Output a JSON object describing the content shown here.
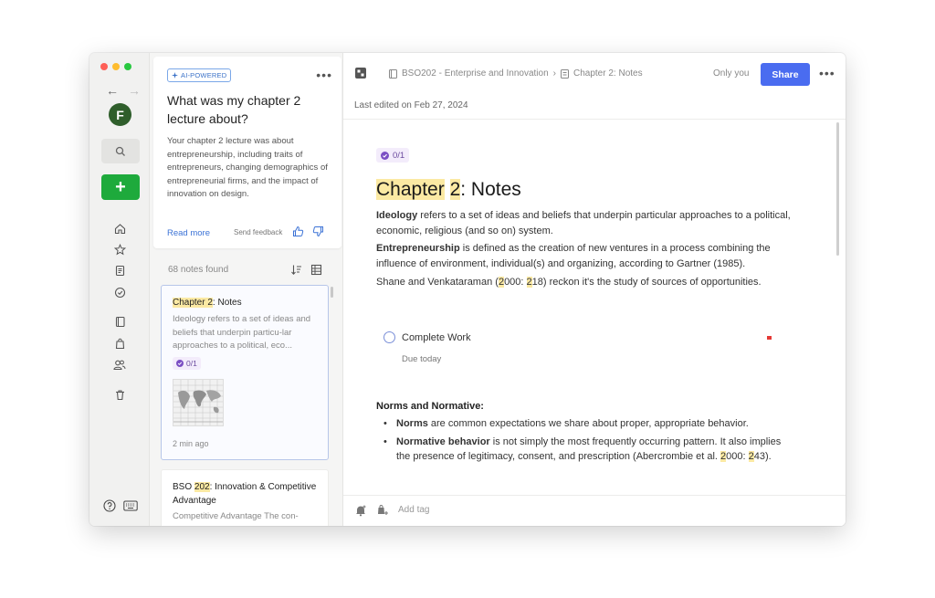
{
  "rail": {
    "avatar_letter": "F"
  },
  "ai_card": {
    "badge": "AI-POWERED",
    "question": "What was my chapter 2 lecture about?",
    "answer": "Your chapter 2 lecture was about entrepreneurship, including traits of entrepreneurs, changing demographics of entrepreneurial firms, and the impact of innovation on design.",
    "read_more": "Read more",
    "send_feedback": "Send feedback"
  },
  "notes_list": {
    "count_label": "68 notes found",
    "items": [
      {
        "title_hl": "Chapter 2",
        "title_rest": ": Notes",
        "preview": "Ideology refers to a set of ideas and beliefs that underpin particu-lar approaches to a political, eco...",
        "badge": "0/1",
        "time": "2 min ago"
      },
      {
        "title_pre": "BSO ",
        "title_hl": "202",
        "title_rest": ": Innovation & Competitive Advantage",
        "preview": "Competitive Advantage The con-"
      }
    ]
  },
  "editor": {
    "breadcrumb": [
      "BSO202 - Enterprise and Innovation",
      "Chapter 2: Notes"
    ],
    "visibility": "Only you",
    "share_label": "Share",
    "last_edited": "Last edited on Feb 27, 2024",
    "task_badge": "0/1",
    "title_hl1": "Chapter",
    "title_hl2": "2",
    "title_rest": ": Notes",
    "ideology_term": "Ideology",
    "ideology_text": " refers to a set of ideas and beliefs that underpin particular approaches to a political, economic, religious (and so on) system.",
    "entre_term": "Entrepreneurship",
    "entre_text": " is defined as the creation of new ventures in a process combining the influence of environment, individual(s) and organizing, according to Gartner (1985).",
    "shane_a": "Shane and Venkataraman (",
    "shane_b": "2",
    "shane_c": "000: ",
    "shane_d": "2",
    "shane_e": "18) reckon it's the study of sources of opportunities.",
    "task_label": "Complete Work",
    "task_due": "Due today",
    "norms_heading": "Norms and Normative:",
    "b1_term": "Norms",
    "b1_text": " are common expectations we share about proper, appropriate behavior.",
    "b2_term": "Normative behavior",
    "b2_text": " is not simply the most frequently occurring pattern. It also implies the presence of legitimacy, consent, and prescription (Abercrombie et al. ",
    "b2_hl1": "2",
    "b2_mid": "000: ",
    "b2_hl2": "2",
    "b2_end": "43).",
    "add_tag": "Add tag"
  },
  "colors": {
    "accent": "#4a6cf0",
    "new_button": "#1eaa3c",
    "highlight": "#fbe9a3",
    "avatar": "#2f5e2b"
  }
}
